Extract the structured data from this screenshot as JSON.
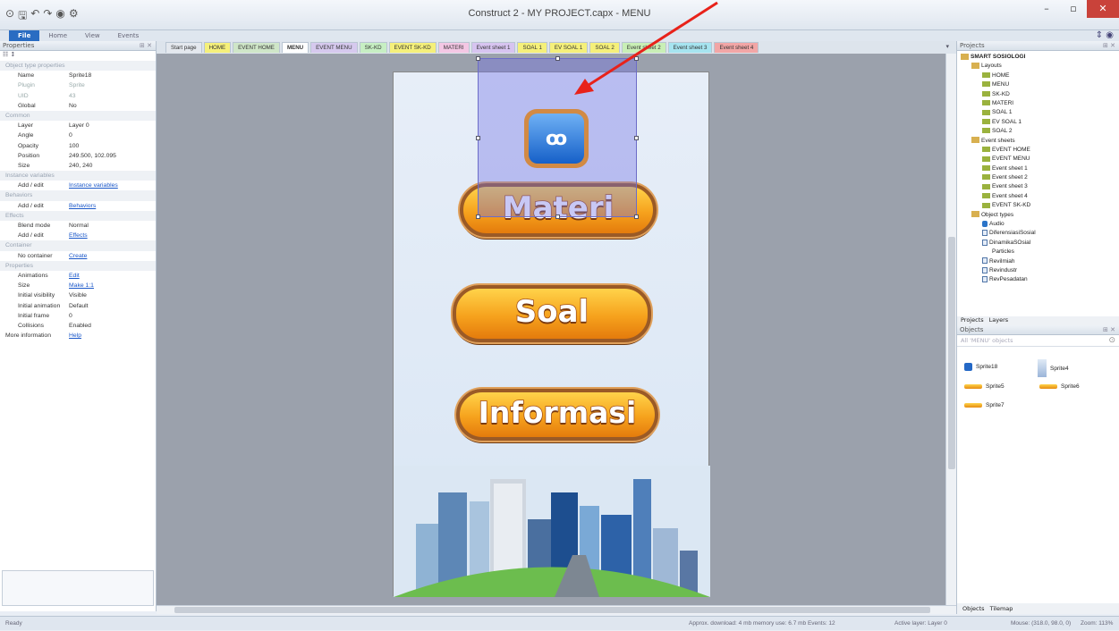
{
  "window": {
    "title": "Construct 2 - MY PROJECT.capx - MENU",
    "min": "–",
    "max": "▫",
    "close": "✕"
  },
  "ribbon": {
    "tabs": [
      "File",
      "Home",
      "View",
      "Events"
    ]
  },
  "properties": {
    "title": "Properties",
    "rows": [
      {
        "type": "cat",
        "k": "Object type properties"
      },
      {
        "k": "Name",
        "v": "Sprite18"
      },
      {
        "k": "Plugin",
        "v": "Sprite",
        "dim": true
      },
      {
        "k": "UID",
        "v": "43",
        "dim": true
      },
      {
        "k": "Global",
        "v": "No"
      },
      {
        "type": "cat",
        "k": "Common"
      },
      {
        "k": "Layer",
        "v": "Layer 0"
      },
      {
        "k": "Angle",
        "v": "0"
      },
      {
        "k": "Opacity",
        "v": "100"
      },
      {
        "k": "Position",
        "v": "249.500, 102.095"
      },
      {
        "k": "Size",
        "v": "240, 240"
      },
      {
        "type": "cat",
        "k": "Instance variables"
      },
      {
        "k": "Add / edit",
        "v": "Instance variables",
        "link": true
      },
      {
        "type": "cat",
        "k": "Behaviors"
      },
      {
        "k": "Add / edit",
        "v": "Behaviors",
        "link": true
      },
      {
        "type": "cat",
        "k": "Effects"
      },
      {
        "k": "Blend mode",
        "v": "Normal"
      },
      {
        "k": "Add / edit",
        "v": "Effects",
        "link": true
      },
      {
        "type": "cat",
        "k": "Container"
      },
      {
        "k": "No container",
        "v": "Create",
        "link": true
      },
      {
        "type": "cat",
        "k": "Properties"
      },
      {
        "k": "Animations",
        "v": "Edit",
        "link": true
      },
      {
        "k": "Size",
        "v": "Make 1:1",
        "link": true
      },
      {
        "k": "Initial visibility",
        "v": "Visible"
      },
      {
        "k": "Initial animation",
        "v": "Default"
      },
      {
        "k": "Initial frame",
        "v": "0"
      },
      {
        "k": "Collisions",
        "v": "Enabled"
      },
      {
        "k": "More information",
        "v": "Help",
        "link": true,
        "top": true
      }
    ]
  },
  "tabs": [
    {
      "label": "Start page",
      "color": "#e4e8ee"
    },
    {
      "label": "HOME",
      "color": "#f5f07a"
    },
    {
      "label": "EVENT HOME",
      "color": "#cfe6c8"
    },
    {
      "label": "MENU",
      "color": "#fff",
      "active": true
    },
    {
      "label": "EVENT MENU",
      "color": "#d6c9ee"
    },
    {
      "label": "SK-KD",
      "color": "#c7efc3"
    },
    {
      "label": "EVENT SK-KD",
      "color": "#f5f07a"
    },
    {
      "label": "MATERI",
      "color": "#f4c7e4"
    },
    {
      "label": "Event sheet 1",
      "color": "#d7c4f0"
    },
    {
      "label": "SOAL 1",
      "color": "#f5f07a"
    },
    {
      "label": "EV SOAL 1",
      "color": "#f5f07a"
    },
    {
      "label": "SOAL 2",
      "color": "#f5f07a"
    },
    {
      "label": "Event sheet 2",
      "color": "#c9efb6"
    },
    {
      "label": "Event sheet 3",
      "color": "#a6e4f0"
    },
    {
      "label": "Event sheet 4",
      "color": "#f2a6a6"
    }
  ],
  "layout": {
    "buttons": [
      "Materi",
      "Soal",
      "Informasi"
    ],
    "icon_glyph": "ꝏ"
  },
  "project": {
    "title": "Projects",
    "items": [
      {
        "t": "SMART SOSIOLOGI",
        "kind": "fo",
        "indent": 0,
        "bold": true
      },
      {
        "t": "Layouts",
        "kind": "fo",
        "indent": 1
      },
      {
        "t": "HOME",
        "kind": "fi",
        "indent": 2
      },
      {
        "t": "MENU",
        "kind": "fi",
        "indent": 2
      },
      {
        "t": "SK-KD",
        "kind": "fi",
        "indent": 2
      },
      {
        "t": "MATERI",
        "kind": "fi",
        "indent": 2
      },
      {
        "t": "SOAL 1",
        "kind": "fi",
        "indent": 2
      },
      {
        "t": "EV SOAL 1",
        "kind": "fi",
        "indent": 2
      },
      {
        "t": "SOAL 2",
        "kind": "fi",
        "indent": 2
      },
      {
        "t": "Event sheets",
        "kind": "fo",
        "indent": 1
      },
      {
        "t": "EVENT HOME",
        "kind": "fi",
        "indent": 2
      },
      {
        "t": "EVENT MENU",
        "kind": "fi",
        "indent": 2
      },
      {
        "t": "Event sheet 1",
        "kind": "fi",
        "indent": 2
      },
      {
        "t": "Event sheet 2",
        "kind": "fi",
        "indent": 2
      },
      {
        "t": "Event sheet 3",
        "kind": "fi",
        "indent": 2
      },
      {
        "t": "Event sheet 4",
        "kind": "fi",
        "indent": 2
      },
      {
        "t": "EVENT SK-KD",
        "kind": "fi",
        "indent": 2
      },
      {
        "t": "Object types",
        "kind": "fo",
        "indent": 1
      },
      {
        "t": "Audio",
        "kind": "au",
        "indent": 2
      },
      {
        "t": "DiferensiasiSosial",
        "kind": "ob",
        "indent": 2
      },
      {
        "t": "DinamikaSOsial",
        "kind": "ob",
        "indent": 2
      },
      {
        "t": "Particles",
        "kind": "none",
        "indent": 2
      },
      {
        "t": "Revilmiah",
        "kind": "ob",
        "indent": 2
      },
      {
        "t": "Revindustr",
        "kind": "ob",
        "indent": 2
      },
      {
        "t": "RevPesadatan",
        "kind": "ob",
        "indent": 2
      }
    ],
    "tabs": [
      "Projects",
      "Layers"
    ]
  },
  "objects": {
    "title": "Objects",
    "search": "All 'MENU' objects",
    "items": [
      {
        "name": "Sprite18",
        "kind": "sq"
      },
      {
        "name": "Sprite4",
        "kind": "tall"
      },
      {
        "name": "Sprite5",
        "kind": "sw"
      },
      {
        "name": "Sprite6",
        "kind": "sw"
      },
      {
        "name": "Sprite7",
        "kind": "sw"
      }
    ],
    "tabs": [
      "Objects",
      "Tilemap"
    ]
  },
  "status": {
    "left": "Ready",
    "approx": "Approx. download: 4 mb  memory use: 6.7 mb  Events: 12",
    "layer": "Active layer: Layer 0",
    "mouse": "Mouse: (318.0, 98.0, 0)",
    "zoom": "Zoom: 113%"
  },
  "colors": {
    "accent": "#2a6cc2",
    "arrow": "#e8221a",
    "selection": "#6e6ee6"
  }
}
